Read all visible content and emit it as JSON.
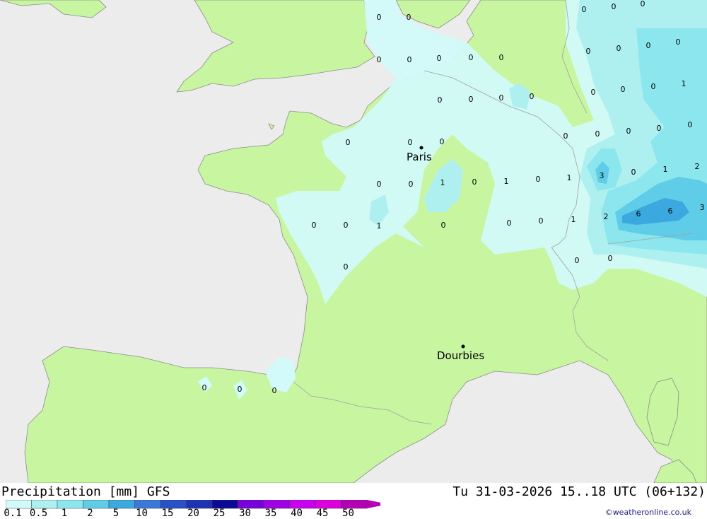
{
  "map": {
    "cities": [
      {
        "name": "Paris"
      },
      {
        "name": "Dourbies"
      }
    ],
    "values": [
      "0",
      "0",
      "0",
      "0",
      "0",
      "0",
      "0",
      "0",
      "0",
      "0",
      "0",
      "0",
      "0",
      "0",
      "1",
      "0",
      "0",
      "0",
      "0",
      "0",
      "0",
      "0",
      "0",
      "0",
      "0",
      "0",
      "0",
      "0",
      "0",
      "3",
      "0",
      "1",
      "2",
      "0",
      "0",
      "1",
      "0",
      "1",
      "0",
      "1",
      "0",
      "0",
      "1",
      "0",
      "0",
      "0",
      "0",
      "1",
      "2",
      "6",
      "6",
      "3",
      "0",
      "0",
      "0",
      "0",
      "0",
      "0"
    ],
    "colors": {
      "sea": "#ececec",
      "land": "#c8f5a0",
      "precip_01": "#d2fafa",
      "precip_05": "#aef0f0",
      "precip_1": "#8ce6ee",
      "precip_2": "#5fcce8",
      "precip_5": "#3ca8e0"
    }
  },
  "legend": {
    "title": "Precipitation [mm] GFS",
    "datetime": "Tu 31-03-2026 15..18 UTC (06+132)",
    "credit": "©weatheronline.co.uk",
    "scale": [
      "0.1",
      "0.5",
      "1",
      "2",
      "5",
      "10",
      "15",
      "20",
      "25",
      "30",
      "35",
      "40",
      "45",
      "50"
    ],
    "scale_colors": [
      "#d2fafa",
      "#aef0f0",
      "#8ce6ee",
      "#5fcce8",
      "#3ca8e0",
      "#3c78d8",
      "#2850c8",
      "#1e32b4",
      "#0a0a96",
      "#7800dc",
      "#a000e6",
      "#c800f0",
      "#dc00dc",
      "#b400b4"
    ]
  }
}
